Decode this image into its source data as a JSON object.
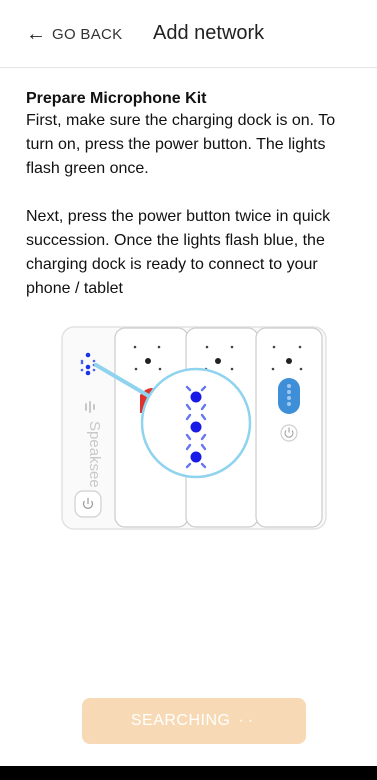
{
  "header": {
    "back_icon": "arrow-left-icon",
    "back_label": "GO BACK",
    "title": "Add network"
  },
  "content": {
    "kit_title": "Prepare Microphone Kit",
    "paragraph_1": "First, make sure the charging dock is on. To turn on, press the power button. The lights flash green once.",
    "paragraph_2": "Next, press the power button twice in quick succession. Once the lights flash blue, the charging dock is ready to connect to your phone / tablet"
  },
  "illustration": {
    "brand_label": "Speaksee",
    "light_color": "#1a33e6",
    "ring_color": "#8fd3ee"
  },
  "actions": {
    "search_label": "SEARCHING",
    "search_dots": "··",
    "search_color": "#f8d9b5"
  }
}
